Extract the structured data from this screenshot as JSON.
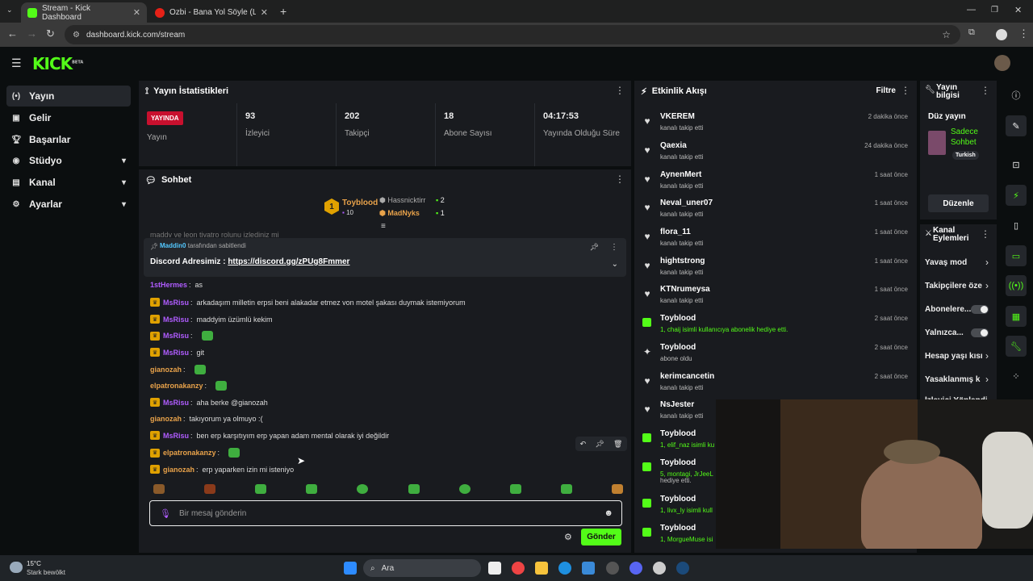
{
  "browser": {
    "tabs": [
      {
        "title": "Stream - Kick Dashboard"
      },
      {
        "title": "Ozbi - Bana Yol Söyle (Lirik Vide"
      }
    ],
    "url": "dashboard.kick.com/stream"
  },
  "sidebar": {
    "items": [
      {
        "label": "Yayın",
        "icon": "broadcast-icon"
      },
      {
        "label": "Gelir",
        "icon": "dollar-icon"
      },
      {
        "label": "Başarılar",
        "icon": "trophy-icon"
      },
      {
        "label": "Stüdyo",
        "icon": "studio-icon"
      },
      {
        "label": "Kanal",
        "icon": "channel-icon"
      },
      {
        "label": "Ayarlar",
        "icon": "gear-icon"
      }
    ]
  },
  "stats": {
    "title": "Yayın İstatistikleri",
    "live_badge": "YAYINDA",
    "live_label": "Yayın",
    "viewers": "93",
    "viewers_label": "İzleyici",
    "followers": "202",
    "followers_label": "Takipçi",
    "subs": "18",
    "subs_label": "Abone Sayısı",
    "uptime": "04:17:53",
    "uptime_label": "Yayında Olduğu Süre"
  },
  "chat": {
    "title": "Sohbet",
    "leaderboard": {
      "rank": "1",
      "top": "Toyblood",
      "top_count": "10",
      "second": "Hassnicktirr",
      "second_count": "2",
      "third": "MadNyks",
      "third_count": "1"
    },
    "cut_line": "maddy ve leon tiyatro rolunu izlediniz mi",
    "pinned": {
      "by": "Maddin0",
      "by_suffix": "tarafından sabitlendi",
      "text": "Discord Adresimiz : ",
      "link": "https://discord.gg/zPUg8Fmmer"
    },
    "messages": [
      {
        "user": "1stHermes",
        "color": "#b05cff",
        "crown": false,
        "text": "as",
        "emote": false
      },
      {
        "user": "MsRisu",
        "color": "#b05cff",
        "crown": true,
        "text": "arkadaşım milletin erpsi beni alakadar etmez von motel şakası duymak istemiyorum",
        "emote": false
      },
      {
        "user": "MsRisu",
        "color": "#b05cff",
        "crown": true,
        "text": "maddyim üzümlü kekim",
        "emote": false
      },
      {
        "user": "MsRisu",
        "color": "#b05cff",
        "crown": true,
        "text": "",
        "emote": true
      },
      {
        "user": "MsRisu",
        "color": "#b05cff",
        "crown": true,
        "text": "git",
        "emote": false
      },
      {
        "user": "gianozah",
        "color": "#e8a24a",
        "crown": false,
        "text": "",
        "emote": true
      },
      {
        "user": "elpatronakanzy",
        "color": "#e8a24a",
        "crown": false,
        "text": "",
        "emote": true
      },
      {
        "user": "MsRisu",
        "color": "#b05cff",
        "crown": true,
        "text": "aha berke @gianozah",
        "emote": false
      },
      {
        "user": "gianozah",
        "color": "#e8a24a",
        "crown": false,
        "text": "takıyorum ya olmuyo :(",
        "emote": false
      },
      {
        "user": "MsRisu",
        "color": "#b05cff",
        "crown": true,
        "text": "ben erp karşıtıyım erp yapan adam mental olarak iyi değildir",
        "emote": false
      },
      {
        "user": "elpatronakanzy",
        "color": "#e8a24a",
        "crown": true,
        "text": "",
        "emote": true
      },
      {
        "user": "gianozah",
        "color": "#e8a24a",
        "crown": true,
        "text": "erp yaparken izin mi isteniyo",
        "emote": false
      }
    ],
    "input_placeholder": "Bir mesaj gönderin",
    "send_label": "Gönder"
  },
  "events": {
    "title": "Etkinlik Akışı",
    "filter_label": "Filtre",
    "items": [
      {
        "name": "VKEREM",
        "sub": "kanalı takip etti",
        "time": "2 dakika önce",
        "icon": "heart-icon"
      },
      {
        "name": "Qaexia",
        "sub": "kanalı takip etti",
        "time": "24 dakika önce",
        "icon": "heart-icon"
      },
      {
        "name": "AynenMert",
        "sub": "kanalı takip etti",
        "time": "1 saat önce",
        "icon": "heart-icon"
      },
      {
        "name": "Neval_uner07",
        "sub": "kanalı takip etti",
        "time": "1 saat önce",
        "icon": "heart-icon"
      },
      {
        "name": "flora_11",
        "sub": "kanalı takip etti",
        "time": "1 saat önce",
        "icon": "heart-icon"
      },
      {
        "name": "hightstrong",
        "sub": "kanalı takip etti",
        "time": "1 saat önce",
        "icon": "heart-icon"
      },
      {
        "name": "KTNrumeysa",
        "sub": "kanalı takip etti",
        "time": "1 saat önce",
        "icon": "heart-icon"
      },
      {
        "name": "Toyblood",
        "sub": "1, chaij isimli kullanıcıya abonelik hediye etti.",
        "time": "2 saat önce",
        "icon": "gift-icon"
      },
      {
        "name": "Toyblood",
        "sub": "abone oldu",
        "time": "2 saat önce",
        "icon": "sparkle-icon"
      },
      {
        "name": "kerimcancetin",
        "sub": "kanalı takip etti",
        "time": "2 saat önce",
        "icon": "heart-icon"
      },
      {
        "name": "NsJester",
        "sub": "kanalı takip etti",
        "time": "",
        "icon": "heart-icon"
      },
      {
        "name": "Toyblood",
        "sub": "1, elif_naz isimli ku",
        "time": "",
        "icon": "gift-icon"
      },
      {
        "name": "Toyblood",
        "sub": "5, montagi, JrJeeL",
        "time": "",
        "icon": "gift-icon"
      },
      {
        "name": "Toyblood",
        "sub": "1, livx_ly isimli kull",
        "time": "",
        "icon": "gift-icon"
      },
      {
        "name": "Toyblood",
        "sub": "1, MorgueMuse isi",
        "time": "",
        "icon": "gift-icon"
      }
    ],
    "extra_line": "hediye etti."
  },
  "info": {
    "title": "Yayın bilgisi",
    "stream_title": "Düz yayın",
    "category": "Sadece Sohbet",
    "language": "Turkish",
    "edit_label": "Düzenle"
  },
  "actions": {
    "title": "Kanal Eylemleri",
    "items": [
      {
        "label": "Yavaş mod",
        "control": "chevron"
      },
      {
        "label": "Takipçilere öze",
        "control": "chevron"
      },
      {
        "label": "Abonelere...",
        "control": "toggle"
      },
      {
        "label": "Yalnızca...",
        "control": "toggle"
      },
      {
        "label": "Hesap yaşı kısı",
        "control": "chevron"
      },
      {
        "label": "Yasaklanmış k",
        "control": "chevron"
      },
      {
        "label": "İzleyici Yönlendir",
        "control": "none"
      }
    ]
  },
  "taskbar": {
    "temp": "15°C",
    "weather": "Stark bewölkt",
    "search": "Ara"
  }
}
